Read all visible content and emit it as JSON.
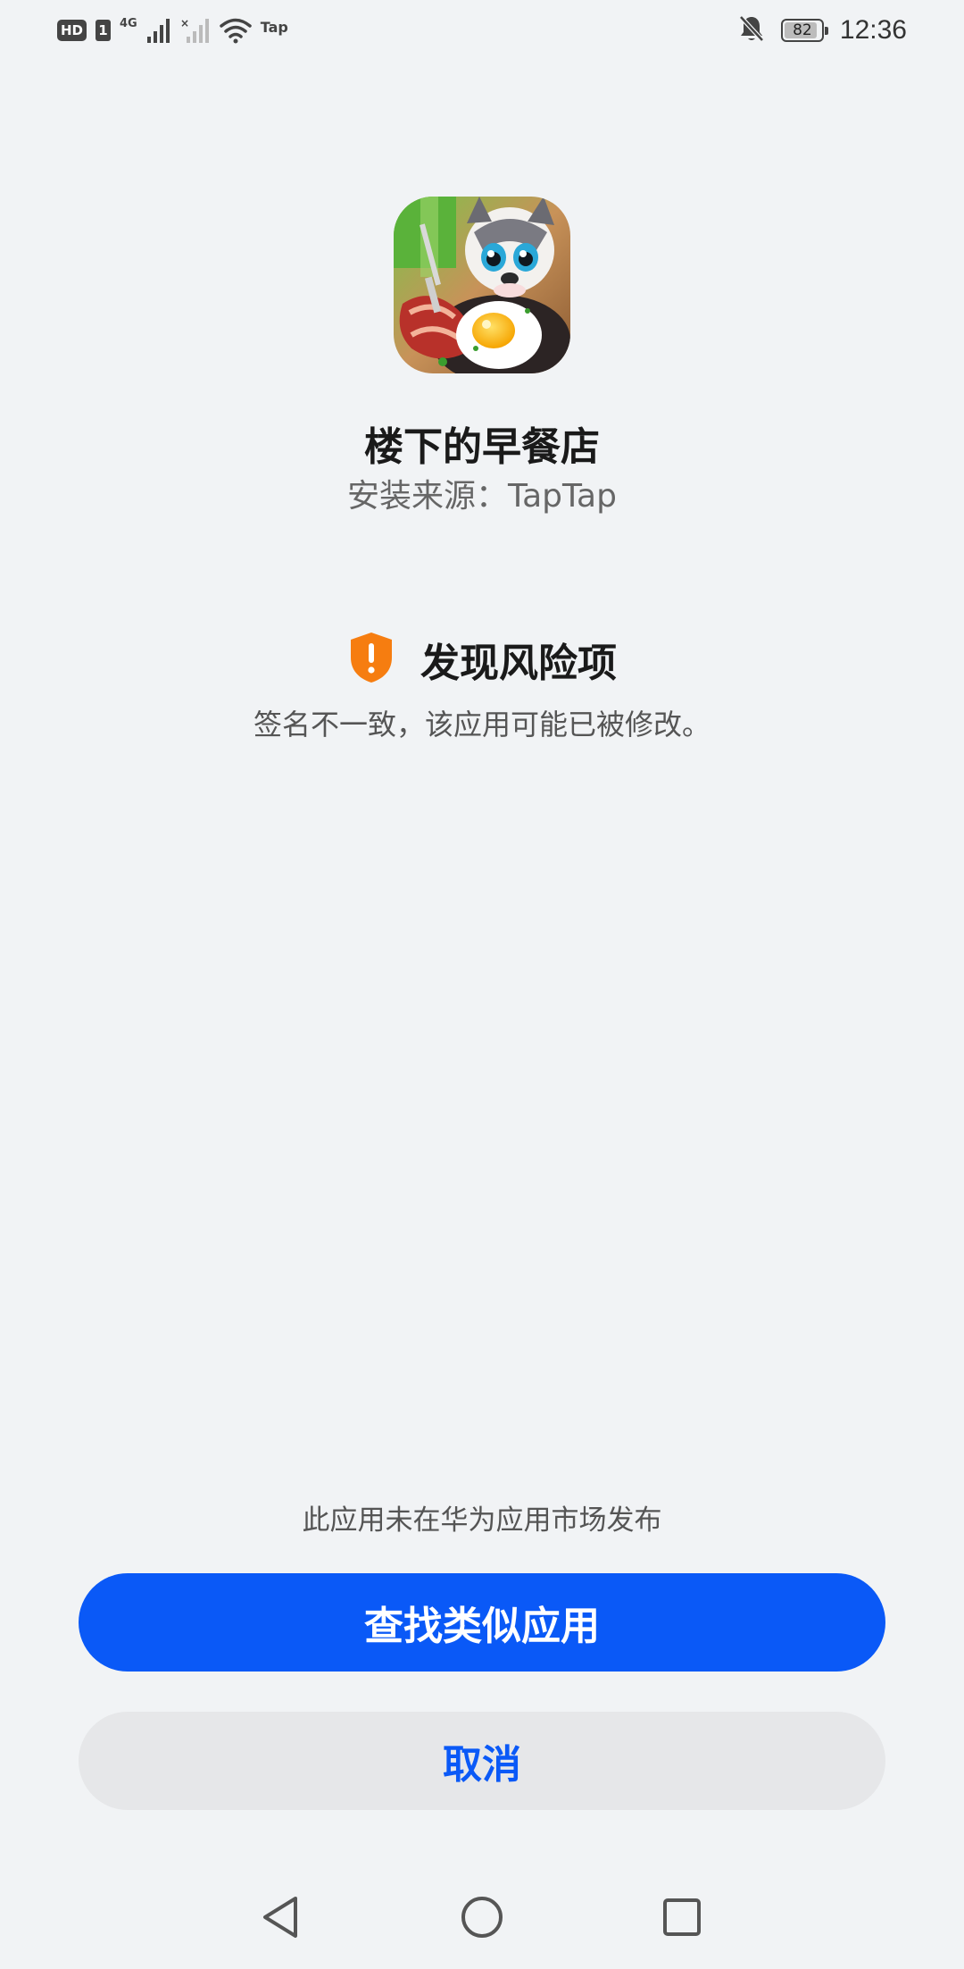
{
  "status_bar": {
    "hd_label": "HD",
    "sim_label": "1",
    "network_label": "4G",
    "carrier_label": "Tap",
    "battery_level": "82",
    "time": "12:36"
  },
  "app": {
    "name": "楼下的早餐店",
    "source": "安装来源：TapTap"
  },
  "risk": {
    "title": "发现风险项",
    "description": "签名不一致，该应用可能已被修改。",
    "accent_color": "#F67D10"
  },
  "notice": "此应用未在华为应用市场发布",
  "buttons": {
    "primary_label": "查找类似应用",
    "cancel_label": "取消",
    "primary_color": "#0A59F7"
  },
  "nav": {
    "back_icon": "back-triangle-icon",
    "home_icon": "home-circle-icon",
    "recents_icon": "recents-square-icon"
  }
}
